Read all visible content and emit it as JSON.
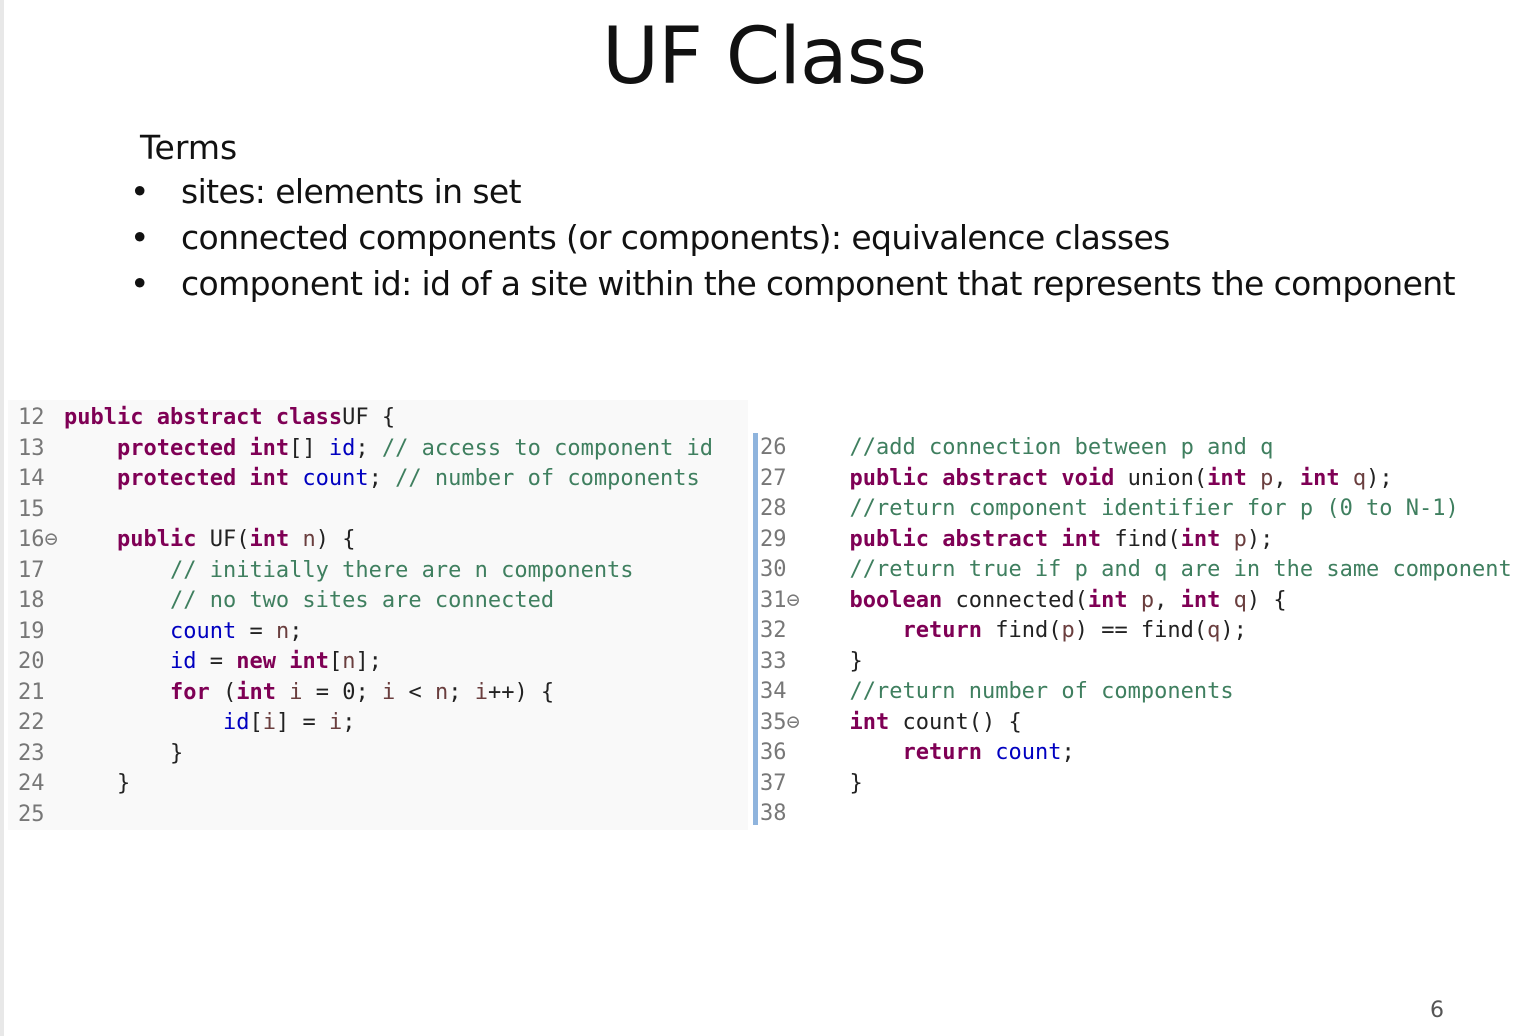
{
  "slide": {
    "title": "UF Class",
    "terms_heading": "Terms",
    "bullets": [
      "sites: elements in set",
      "connected components (or components): equivalence classes",
      "component id: id of a site within the component that represents the component"
    ],
    "bullet_symbol": "•",
    "page_number": "6"
  },
  "code_left": [
    {
      "n": "12",
      "tokens": [
        [
          "kw",
          "public abstract class"
        ],
        [
          "",
          "UF {"
        ]
      ]
    },
    {
      "n": "13",
      "tokens": [
        [
          "",
          "    "
        ],
        [
          "kw",
          "protected int"
        ],
        [
          "",
          "[] "
        ],
        [
          "fd",
          "id"
        ],
        [
          "",
          "; "
        ],
        [
          "cm",
          "// access to component id"
        ]
      ]
    },
    {
      "n": "14",
      "tokens": [
        [
          "",
          "    "
        ],
        [
          "kw",
          "protected int"
        ],
        [
          "",
          "",
          " "
        ],
        [
          "fd",
          "count"
        ],
        [
          "",
          "; "
        ],
        [
          "cm",
          "// number of components"
        ]
      ]
    },
    {
      "n": "15",
      "tokens": []
    },
    {
      "n": "16⊖",
      "tokens": [
        [
          "",
          "    "
        ],
        [
          "kw",
          "public"
        ],
        [
          "",
          " UF("
        ],
        [
          "kw",
          "int"
        ],
        [
          "",
          " "
        ],
        [
          "pm",
          "n"
        ],
        [
          "",
          ") {"
        ]
      ]
    },
    {
      "n": "17",
      "tokens": [
        [
          "",
          "        "
        ],
        [
          "cm",
          "// initially there are n components"
        ]
      ]
    },
    {
      "n": "18",
      "tokens": [
        [
          "",
          "        "
        ],
        [
          "cm",
          "// no two sites are connected"
        ]
      ]
    },
    {
      "n": "19",
      "tokens": [
        [
          "",
          "        "
        ],
        [
          "fd",
          "count"
        ],
        [
          "",
          " = "
        ],
        [
          "pm",
          "n"
        ],
        [
          "",
          ";"
        ]
      ]
    },
    {
      "n": "20",
      "tokens": [
        [
          "",
          "        "
        ],
        [
          "fd",
          "id"
        ],
        [
          "",
          " = "
        ],
        [
          "kw",
          "new int"
        ],
        [
          "",
          "["
        ],
        [
          "pm",
          "n"
        ],
        [
          "",
          "];"
        ]
      ]
    },
    {
      "n": "21",
      "tokens": [
        [
          "",
          "        "
        ],
        [
          "kw",
          "for"
        ],
        [
          "",
          " ("
        ],
        [
          "kw",
          "int"
        ],
        [
          "",
          "",
          " "
        ],
        [
          "pm",
          "i"
        ],
        [
          "",
          " = 0; "
        ],
        [
          "pm",
          "i"
        ],
        [
          "",
          " < "
        ],
        [
          "pm",
          "n"
        ],
        [
          "",
          "; "
        ],
        [
          "pm",
          "i"
        ],
        [
          "",
          "++) {"
        ]
      ]
    },
    {
      "n": "22",
      "tokens": [
        [
          "",
          "            "
        ],
        [
          "fd",
          "id"
        ],
        [
          "",
          "["
        ],
        [
          "pm",
          "i"
        ],
        [
          "",
          "] = "
        ],
        [
          "pm",
          "i"
        ],
        [
          "",
          ";"
        ]
      ]
    },
    {
      "n": "23",
      "tokens": [
        [
          "",
          "        }"
        ]
      ]
    },
    {
      "n": "24",
      "tokens": [
        [
          "",
          "    }"
        ]
      ]
    },
    {
      "n": "25",
      "tokens": []
    }
  ],
  "code_right": [
    {
      "n": "26",
      "tokens": [
        [
          "",
          "  "
        ],
        [
          "cm",
          "//add connection between p and q"
        ]
      ]
    },
    {
      "n": "27",
      "tokens": [
        [
          "",
          "  "
        ],
        [
          "kw",
          "public abstract void"
        ],
        [
          "",
          " union("
        ],
        [
          "kw",
          "int"
        ],
        [
          "",
          " "
        ],
        [
          "pm",
          "p"
        ],
        [
          "",
          ", "
        ],
        [
          "kw",
          "int"
        ],
        [
          "",
          " "
        ],
        [
          "pm",
          "q"
        ],
        [
          "",
          ");"
        ]
      ]
    },
    {
      "n": "28",
      "tokens": [
        [
          "",
          "  "
        ],
        [
          "cm",
          "//return component identifier for p (0 to N-1)"
        ]
      ]
    },
    {
      "n": "29",
      "tokens": [
        [
          "",
          "  "
        ],
        [
          "kw",
          "public abstract int"
        ],
        [
          "",
          " find("
        ],
        [
          "kw",
          "int"
        ],
        [
          "",
          " "
        ],
        [
          "pm",
          "p"
        ],
        [
          "",
          ");"
        ]
      ]
    },
    {
      "n": "30",
      "tokens": [
        [
          "",
          "  "
        ],
        [
          "cm",
          "//return true if p and q are in the same component"
        ]
      ]
    },
    {
      "n": "31⊖",
      "tokens": [
        [
          "",
          "  "
        ],
        [
          "kw",
          "boolean"
        ],
        [
          "",
          " connected("
        ],
        [
          "kw",
          "int"
        ],
        [
          "",
          " "
        ],
        [
          "pm",
          "p"
        ],
        [
          "",
          ", "
        ],
        [
          "kw",
          "int"
        ],
        [
          "",
          " "
        ],
        [
          "pm",
          "q"
        ],
        [
          "",
          ") {"
        ]
      ]
    },
    {
      "n": "32",
      "tokens": [
        [
          "",
          "      "
        ],
        [
          "kw",
          "return"
        ],
        [
          "",
          " find("
        ],
        [
          "pm",
          "p"
        ],
        [
          "",
          ") == find("
        ],
        [
          "pm",
          "q"
        ],
        [
          "",
          ");"
        ]
      ]
    },
    {
      "n": "33",
      "tokens": [
        [
          "",
          "  }"
        ]
      ]
    },
    {
      "n": "34",
      "tokens": [
        [
          "",
          "  "
        ],
        [
          "cm",
          "//return number of components"
        ]
      ]
    },
    {
      "n": "35⊖",
      "tokens": [
        [
          "",
          "  "
        ],
        [
          "kw",
          "int"
        ],
        [
          "",
          " count() {"
        ]
      ]
    },
    {
      "n": "36",
      "tokens": [
        [
          "",
          "      "
        ],
        [
          "kw",
          "return"
        ],
        [
          "",
          " "
        ],
        [
          "fd",
          "count"
        ],
        [
          "",
          ";"
        ]
      ]
    },
    {
      "n": "37",
      "tokens": [
        [
          "",
          "  }"
        ]
      ]
    },
    {
      "n": "38",
      "tokens": []
    }
  ]
}
